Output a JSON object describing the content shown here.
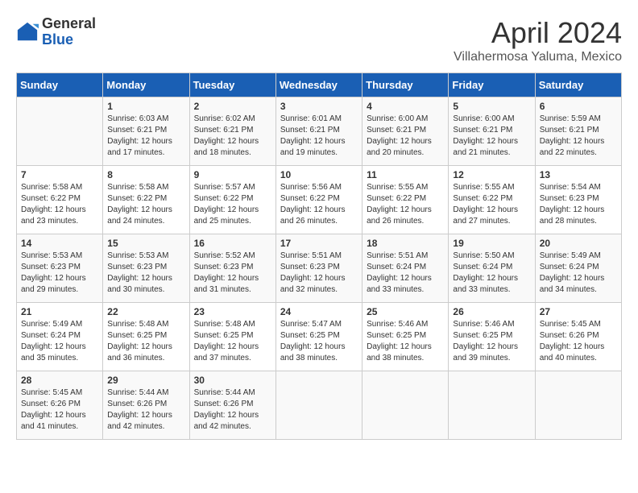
{
  "header": {
    "logo_general": "General",
    "logo_blue": "Blue",
    "month_title": "April 2024",
    "subtitle": "Villahermosa Yaluma, Mexico"
  },
  "calendar": {
    "days_of_week": [
      "Sunday",
      "Monday",
      "Tuesday",
      "Wednesday",
      "Thursday",
      "Friday",
      "Saturday"
    ],
    "weeks": [
      [
        {
          "day": "",
          "info": ""
        },
        {
          "day": "1",
          "info": "Sunrise: 6:03 AM\nSunset: 6:21 PM\nDaylight: 12 hours\nand 17 minutes."
        },
        {
          "day": "2",
          "info": "Sunrise: 6:02 AM\nSunset: 6:21 PM\nDaylight: 12 hours\nand 18 minutes."
        },
        {
          "day": "3",
          "info": "Sunrise: 6:01 AM\nSunset: 6:21 PM\nDaylight: 12 hours\nand 19 minutes."
        },
        {
          "day": "4",
          "info": "Sunrise: 6:00 AM\nSunset: 6:21 PM\nDaylight: 12 hours\nand 20 minutes."
        },
        {
          "day": "5",
          "info": "Sunrise: 6:00 AM\nSunset: 6:21 PM\nDaylight: 12 hours\nand 21 minutes."
        },
        {
          "day": "6",
          "info": "Sunrise: 5:59 AM\nSunset: 6:21 PM\nDaylight: 12 hours\nand 22 minutes."
        }
      ],
      [
        {
          "day": "7",
          "info": "Sunrise: 5:58 AM\nSunset: 6:22 PM\nDaylight: 12 hours\nand 23 minutes."
        },
        {
          "day": "8",
          "info": "Sunrise: 5:58 AM\nSunset: 6:22 PM\nDaylight: 12 hours\nand 24 minutes."
        },
        {
          "day": "9",
          "info": "Sunrise: 5:57 AM\nSunset: 6:22 PM\nDaylight: 12 hours\nand 25 minutes."
        },
        {
          "day": "10",
          "info": "Sunrise: 5:56 AM\nSunset: 6:22 PM\nDaylight: 12 hours\nand 26 minutes."
        },
        {
          "day": "11",
          "info": "Sunrise: 5:55 AM\nSunset: 6:22 PM\nDaylight: 12 hours\nand 26 minutes."
        },
        {
          "day": "12",
          "info": "Sunrise: 5:55 AM\nSunset: 6:22 PM\nDaylight: 12 hours\nand 27 minutes."
        },
        {
          "day": "13",
          "info": "Sunrise: 5:54 AM\nSunset: 6:23 PM\nDaylight: 12 hours\nand 28 minutes."
        }
      ],
      [
        {
          "day": "14",
          "info": "Sunrise: 5:53 AM\nSunset: 6:23 PM\nDaylight: 12 hours\nand 29 minutes."
        },
        {
          "day": "15",
          "info": "Sunrise: 5:53 AM\nSunset: 6:23 PM\nDaylight: 12 hours\nand 30 minutes."
        },
        {
          "day": "16",
          "info": "Sunrise: 5:52 AM\nSunset: 6:23 PM\nDaylight: 12 hours\nand 31 minutes."
        },
        {
          "day": "17",
          "info": "Sunrise: 5:51 AM\nSunset: 6:23 PM\nDaylight: 12 hours\nand 32 minutes."
        },
        {
          "day": "18",
          "info": "Sunrise: 5:51 AM\nSunset: 6:24 PM\nDaylight: 12 hours\nand 33 minutes."
        },
        {
          "day": "19",
          "info": "Sunrise: 5:50 AM\nSunset: 6:24 PM\nDaylight: 12 hours\nand 33 minutes."
        },
        {
          "day": "20",
          "info": "Sunrise: 5:49 AM\nSunset: 6:24 PM\nDaylight: 12 hours\nand 34 minutes."
        }
      ],
      [
        {
          "day": "21",
          "info": "Sunrise: 5:49 AM\nSunset: 6:24 PM\nDaylight: 12 hours\nand 35 minutes."
        },
        {
          "day": "22",
          "info": "Sunrise: 5:48 AM\nSunset: 6:25 PM\nDaylight: 12 hours\nand 36 minutes."
        },
        {
          "day": "23",
          "info": "Sunrise: 5:48 AM\nSunset: 6:25 PM\nDaylight: 12 hours\nand 37 minutes."
        },
        {
          "day": "24",
          "info": "Sunrise: 5:47 AM\nSunset: 6:25 PM\nDaylight: 12 hours\nand 38 minutes."
        },
        {
          "day": "25",
          "info": "Sunrise: 5:46 AM\nSunset: 6:25 PM\nDaylight: 12 hours\nand 38 minutes."
        },
        {
          "day": "26",
          "info": "Sunrise: 5:46 AM\nSunset: 6:25 PM\nDaylight: 12 hours\nand 39 minutes."
        },
        {
          "day": "27",
          "info": "Sunrise: 5:45 AM\nSunset: 6:26 PM\nDaylight: 12 hours\nand 40 minutes."
        }
      ],
      [
        {
          "day": "28",
          "info": "Sunrise: 5:45 AM\nSunset: 6:26 PM\nDaylight: 12 hours\nand 41 minutes."
        },
        {
          "day": "29",
          "info": "Sunrise: 5:44 AM\nSunset: 6:26 PM\nDaylight: 12 hours\nand 42 minutes."
        },
        {
          "day": "30",
          "info": "Sunrise: 5:44 AM\nSunset: 6:26 PM\nDaylight: 12 hours\nand 42 minutes."
        },
        {
          "day": "",
          "info": ""
        },
        {
          "day": "",
          "info": ""
        },
        {
          "day": "",
          "info": ""
        },
        {
          "day": "",
          "info": ""
        }
      ]
    ]
  }
}
